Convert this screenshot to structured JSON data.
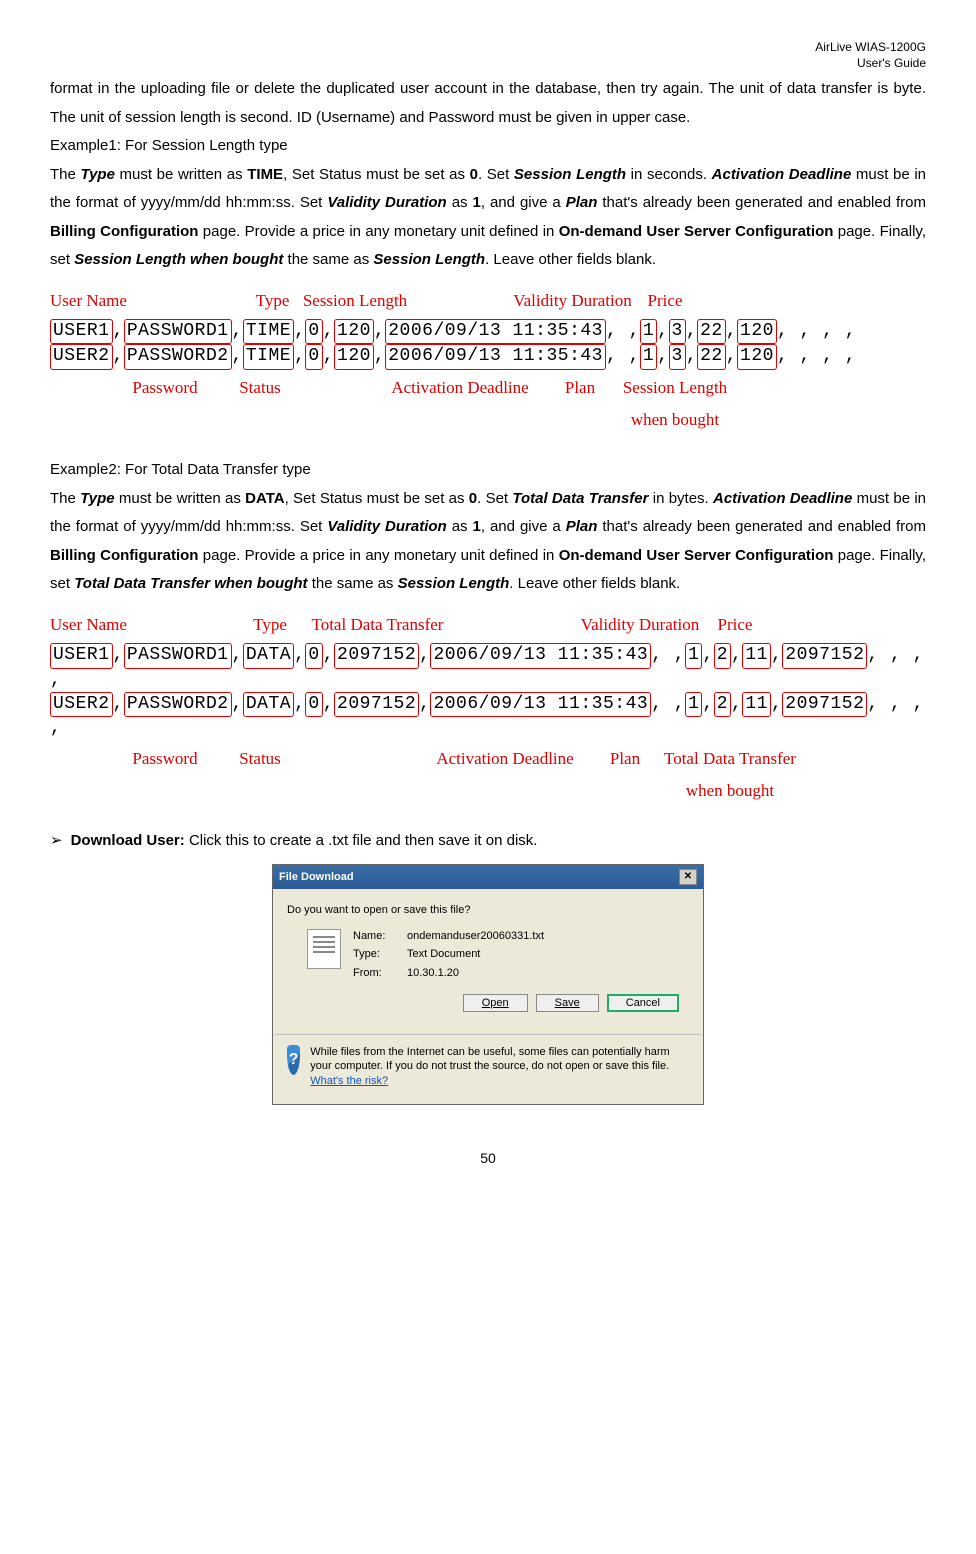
{
  "header": {
    "l1": "AirLive WIAS-1200G",
    "l2": "User's Guide"
  },
  "intro": {
    "p1a": "format in the uploading file or delete the duplicated user account in the database, then try again. The unit of data transfer is byte. The unit of session length is second. ID (Username) and Password must be given in upper case.",
    "ex1title": "Example1: For Session Length type",
    "ex1_the": "The ",
    "ex1_type": "Type",
    "ex1_s1": " must be written as ",
    "ex1_time": "TIME",
    "ex1_s2": ", Set Status must be set as ",
    "ex1_zero": "0",
    "ex1_s3": ". Set ",
    "ex1_sesslen": "Session Length",
    "ex1_s4": " in seconds. ",
    "ex1_actdl": "Activation Deadline",
    "ex1_s5": " must be in the format of yyyy/mm/dd hh:mm:ss. Set ",
    "ex1_valdur": "Validity Duration",
    "ex1_s6": " as ",
    "ex1_one": "1",
    "ex1_s7": ", and give a ",
    "ex1_plan": "Plan",
    "ex1_s8": " that's already been generated and enabled from ",
    "ex1_billcfg": "Billing Configuration",
    "ex1_s9": " page. Provide a price in any monetary unit defined in ",
    "ex1_ondemand": "On-demand User Server Configuration",
    "ex1_s10": " page. Finally, set ",
    "ex1_slwb": "Session Length when bought",
    "ex1_s11": " the same as ",
    "ex1_sesslen2": "Session Length",
    "ex1_s12": ". Leave other fields blank.",
    "ex2title": "Example2: For Total Data Transfer type",
    "ex2_the": "The ",
    "ex2_type": "Type",
    "ex2_s1": " must be written as ",
    "ex2_data": "DATA",
    "ex2_s2": ", Set Status must be set as ",
    "ex2_zero": "0",
    "ex2_s3": ". Set ",
    "ex2_tdt": "Total Data Transfer",
    "ex2_s4": " in bytes. ",
    "ex2_actdl": "Activation Deadline",
    "ex2_s5": " must be in the format of yyyy/mm/dd hh:mm:ss. Set ",
    "ex2_valdur": "Validity Duration",
    "ex2_s6": " as ",
    "ex2_one": "1",
    "ex2_s7": ", and give a ",
    "ex2_plan": "Plan",
    "ex2_s8": " that's already been generated and enabled from ",
    "ex2_billcfg": "Billing Configuration",
    "ex2_s9": " page. Provide a price in any monetary unit defined in ",
    "ex2_ondemand": "On-demand User Server Configuration",
    "ex2_s10": " page. Finally, set ",
    "ex2_tdtwb": "Total Data Transfer when bought",
    "ex2_s11": " the same as ",
    "ex2_sesslen2": "Session Length",
    "ex2_s12": ". Leave other fields blank."
  },
  "fig1": {
    "labels_top": {
      "username": "User Name",
      "type": "Type",
      "sesslen": "Session Length",
      "valdur": "Validity Duration",
      "price": "Price"
    },
    "labels_bottom": {
      "password": "Password",
      "status": "Status",
      "actdl": "Activation Deadline",
      "plan": "Plan",
      "slwb1": "Session Length",
      "slwb2": "when bought"
    },
    "rows": [
      {
        "user": "USER1",
        "pass": "PASSWORD1",
        "type": "TIME",
        "status": "0",
        "sl": "120",
        "ad": "2006/09/13 11:35:43",
        "vd": "1",
        "plan": "3",
        "price": "22",
        "slwb": "120",
        "tail": ", , , ,"
      },
      {
        "user": "USER2",
        "pass": "PASSWORD2",
        "type": "TIME",
        "status": "0",
        "sl": "120",
        "ad": "2006/09/13 11:35:43",
        "vd": "1",
        "plan": "3",
        "price": "22",
        "slwb": "120",
        "tail": ", , , ,"
      }
    ]
  },
  "fig2": {
    "labels_top": {
      "username": "User Name",
      "type": "Type",
      "tdt": "Total Data Transfer",
      "valdur": "Validity Duration",
      "price": "Price"
    },
    "labels_bottom": {
      "password": "Password",
      "status": "Status",
      "actdl": "Activation Deadline",
      "plan": "Plan",
      "tdtwb1": "Total Data Transfer",
      "tdtwb2": "when bought"
    },
    "rows": [
      {
        "user": "USER1",
        "pass": "PASSWORD1",
        "type": "DATA",
        "status": "0",
        "tdt": "2097152",
        "ad": "2006/09/13 11:35:43",
        "vd": "1",
        "plan": "2",
        "price": "11",
        "tdtwb": "2097152",
        "tail": ", , , ,"
      },
      {
        "user": "USER2",
        "pass": "PASSWORD2",
        "type": "DATA",
        "status": "0",
        "tdt": "2097152",
        "ad": "2006/09/13 11:35:43",
        "vd": "1",
        "plan": "2",
        "price": "11",
        "tdtwb": "2097152",
        "tail": ", , , ,"
      }
    ]
  },
  "download": {
    "bullet": "➢",
    "label": "Download User: ",
    "text": "Click this to create a .txt file and then save it on disk."
  },
  "dialog": {
    "title": "File Download",
    "close": "✕",
    "question": "Do you want to open or save this file?",
    "name_k": "Name:",
    "name_v": "ondemanduser20060331.txt",
    "type_k": "Type:",
    "type_v": "Text Document",
    "from_k": "From:",
    "from_v": "10.30.1.20",
    "open": "Open",
    "save": "Save",
    "cancel": "Cancel",
    "warn": "While files from the Internet can be useful, some files can potentially harm your computer. If you do not trust the source, do not open or save this file. ",
    "risk": "What's the risk?",
    "shield": "?"
  },
  "pagenum": "50"
}
